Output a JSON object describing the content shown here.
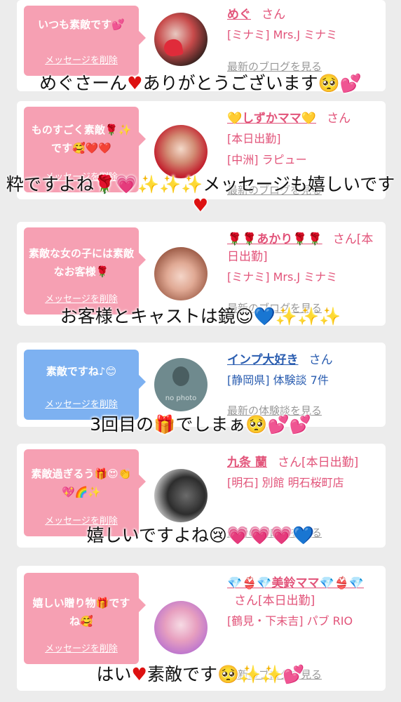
{
  "cards": [
    {
      "bubble_text": "いつも素敵です",
      "bubble_emoji": "💕",
      "delete_label": "メッセージを削除",
      "user_name": "めぐ",
      "honorific": "さん",
      "line1": "[ミナミ] Mrs.J ミナミ",
      "link": "最新のブログを見る",
      "overlay": "めぐさーん",
      "overlay_emoji1": "♥",
      "overlay_mid": "ありがとうございます",
      "overlay_emoji2": "🥺💕"
    },
    {
      "bubble_text": "ものすごく素敵",
      "bubble_emoji": "🌹✨です🥰❤️❤️",
      "delete_label": "メッセージを削除",
      "user_name": "💛しずかママ💛",
      "honorific": "さん",
      "line1": "[本日出勤]",
      "line2": "[中洲] ラピュー",
      "link": "最新のブログを見る",
      "overlay": "粋ですよね🌹💗✨✨✨メッセージも嬉しいです",
      "overlay_emoji1": "♥"
    },
    {
      "bubble_text": "素敵な女の子には素敵なお客様",
      "bubble_emoji": "🌹",
      "delete_label": "メッセージを削除",
      "user_name": "🌹🌹あかり🌹🌹",
      "honorific": "さん[本日出勤]",
      "line1": "[ミナミ] Mrs.J ミナミ",
      "link": "最新のブログを見る",
      "overlay": "お客様とキャストは鏡",
      "overlay_emoji1": "😌💙✨✨✨"
    },
    {
      "bubble_text": "素敵ですね♪",
      "bubble_emoji": "😊",
      "delete_label": "メッセージを削除",
      "user_name": "インプ大好き",
      "honorific": "さん",
      "line1": "[静岡県] 体験談 7件",
      "link": "最新の体験談を見る",
      "avatar_text": "no photo",
      "overlay": "3回目の",
      "overlay_emoji1": "🎁",
      "overlay_mid": "でしまぁ",
      "overlay_emoji2": "🥺💕💕"
    },
    {
      "bubble_text": "素敵過ぎるう",
      "bubble_emoji": "🎁😍👏💖🌈✨",
      "delete_label": "メッセージを削除",
      "user_name": "九条 蘭",
      "honorific": "さん[本日出勤]",
      "line1": "[明石] 別館 明石桜町店",
      "link": "最新のブログを見る",
      "overlay": "嬉しいですよね",
      "overlay_emoji1": "😢💗💗💗💙"
    },
    {
      "bubble_text": "嬉しい贈り物",
      "bubble_emoji": "🎁ですね🥰",
      "delete_label": "メッセージを削除",
      "user_name": "💎👙💎美鈴ママ💎👙💎",
      "honorific": "さん[本日出勤]",
      "line1": "[鶴見・下末吉] パブ RIO",
      "link": "最新のブログを見る",
      "overlay": "はい",
      "overlay_emoji1": "♥",
      "overlay_mid": "素敵です",
      "overlay_emoji2": "🥺✨✨💕"
    }
  ]
}
